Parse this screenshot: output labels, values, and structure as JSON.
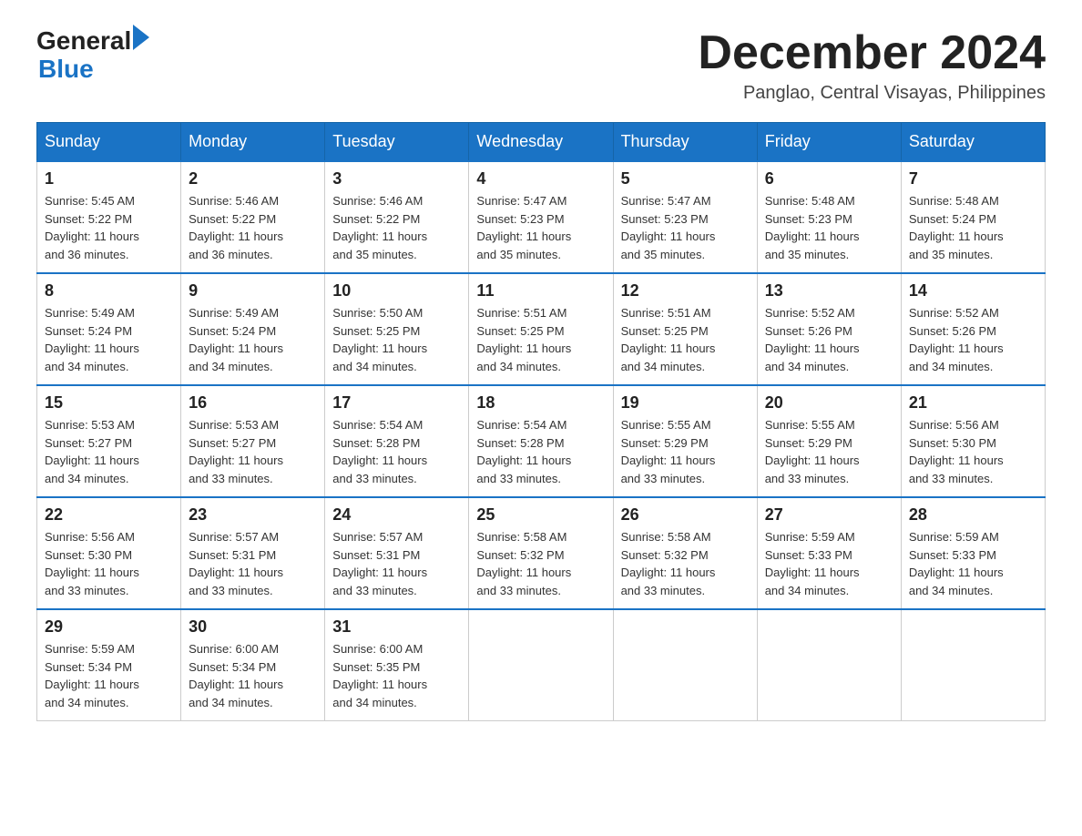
{
  "header": {
    "logo_general": "General",
    "logo_blue": "Blue",
    "month_title": "December 2024",
    "location": "Panglao, Central Visayas, Philippines"
  },
  "days_of_week": [
    "Sunday",
    "Monday",
    "Tuesday",
    "Wednesday",
    "Thursday",
    "Friday",
    "Saturday"
  ],
  "weeks": [
    [
      {
        "day": "1",
        "sunrise": "5:45 AM",
        "sunset": "5:22 PM",
        "daylight": "11 hours and 36 minutes."
      },
      {
        "day": "2",
        "sunrise": "5:46 AM",
        "sunset": "5:22 PM",
        "daylight": "11 hours and 36 minutes."
      },
      {
        "day": "3",
        "sunrise": "5:46 AM",
        "sunset": "5:22 PM",
        "daylight": "11 hours and 35 minutes."
      },
      {
        "day": "4",
        "sunrise": "5:47 AM",
        "sunset": "5:23 PM",
        "daylight": "11 hours and 35 minutes."
      },
      {
        "day": "5",
        "sunrise": "5:47 AM",
        "sunset": "5:23 PM",
        "daylight": "11 hours and 35 minutes."
      },
      {
        "day": "6",
        "sunrise": "5:48 AM",
        "sunset": "5:23 PM",
        "daylight": "11 hours and 35 minutes."
      },
      {
        "day": "7",
        "sunrise": "5:48 AM",
        "sunset": "5:24 PM",
        "daylight": "11 hours and 35 minutes."
      }
    ],
    [
      {
        "day": "8",
        "sunrise": "5:49 AM",
        "sunset": "5:24 PM",
        "daylight": "11 hours and 34 minutes."
      },
      {
        "day": "9",
        "sunrise": "5:49 AM",
        "sunset": "5:24 PM",
        "daylight": "11 hours and 34 minutes."
      },
      {
        "day": "10",
        "sunrise": "5:50 AM",
        "sunset": "5:25 PM",
        "daylight": "11 hours and 34 minutes."
      },
      {
        "day": "11",
        "sunrise": "5:51 AM",
        "sunset": "5:25 PM",
        "daylight": "11 hours and 34 minutes."
      },
      {
        "day": "12",
        "sunrise": "5:51 AM",
        "sunset": "5:25 PM",
        "daylight": "11 hours and 34 minutes."
      },
      {
        "day": "13",
        "sunrise": "5:52 AM",
        "sunset": "5:26 PM",
        "daylight": "11 hours and 34 minutes."
      },
      {
        "day": "14",
        "sunrise": "5:52 AM",
        "sunset": "5:26 PM",
        "daylight": "11 hours and 34 minutes."
      }
    ],
    [
      {
        "day": "15",
        "sunrise": "5:53 AM",
        "sunset": "5:27 PM",
        "daylight": "11 hours and 34 minutes."
      },
      {
        "day": "16",
        "sunrise": "5:53 AM",
        "sunset": "5:27 PM",
        "daylight": "11 hours and 33 minutes."
      },
      {
        "day": "17",
        "sunrise": "5:54 AM",
        "sunset": "5:28 PM",
        "daylight": "11 hours and 33 minutes."
      },
      {
        "day": "18",
        "sunrise": "5:54 AM",
        "sunset": "5:28 PM",
        "daylight": "11 hours and 33 minutes."
      },
      {
        "day": "19",
        "sunrise": "5:55 AM",
        "sunset": "5:29 PM",
        "daylight": "11 hours and 33 minutes."
      },
      {
        "day": "20",
        "sunrise": "5:55 AM",
        "sunset": "5:29 PM",
        "daylight": "11 hours and 33 minutes."
      },
      {
        "day": "21",
        "sunrise": "5:56 AM",
        "sunset": "5:30 PM",
        "daylight": "11 hours and 33 minutes."
      }
    ],
    [
      {
        "day": "22",
        "sunrise": "5:56 AM",
        "sunset": "5:30 PM",
        "daylight": "11 hours and 33 minutes."
      },
      {
        "day": "23",
        "sunrise": "5:57 AM",
        "sunset": "5:31 PM",
        "daylight": "11 hours and 33 minutes."
      },
      {
        "day": "24",
        "sunrise": "5:57 AM",
        "sunset": "5:31 PM",
        "daylight": "11 hours and 33 minutes."
      },
      {
        "day": "25",
        "sunrise": "5:58 AM",
        "sunset": "5:32 PM",
        "daylight": "11 hours and 33 minutes."
      },
      {
        "day": "26",
        "sunrise": "5:58 AM",
        "sunset": "5:32 PM",
        "daylight": "11 hours and 33 minutes."
      },
      {
        "day": "27",
        "sunrise": "5:59 AM",
        "sunset": "5:33 PM",
        "daylight": "11 hours and 34 minutes."
      },
      {
        "day": "28",
        "sunrise": "5:59 AM",
        "sunset": "5:33 PM",
        "daylight": "11 hours and 34 minutes."
      }
    ],
    [
      {
        "day": "29",
        "sunrise": "5:59 AM",
        "sunset": "5:34 PM",
        "daylight": "11 hours and 34 minutes."
      },
      {
        "day": "30",
        "sunrise": "6:00 AM",
        "sunset": "5:34 PM",
        "daylight": "11 hours and 34 minutes."
      },
      {
        "day": "31",
        "sunrise": "6:00 AM",
        "sunset": "5:35 PM",
        "daylight": "11 hours and 34 minutes."
      },
      null,
      null,
      null,
      null
    ]
  ],
  "labels": {
    "sunrise": "Sunrise:",
    "sunset": "Sunset:",
    "daylight": "Daylight:"
  }
}
